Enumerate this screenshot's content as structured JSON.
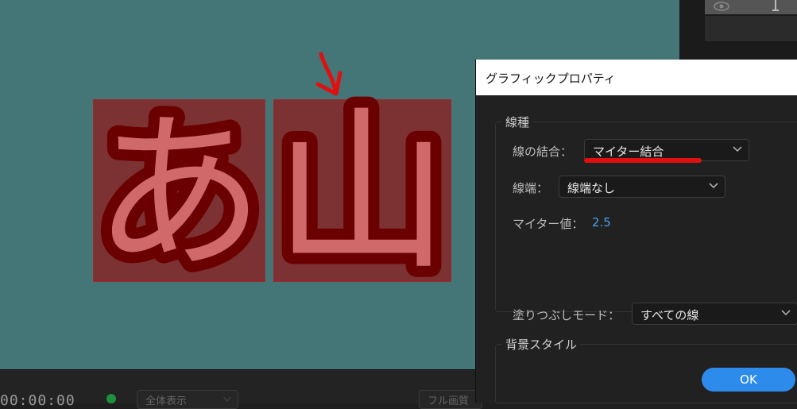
{
  "preview": {
    "glyph_left": "あ",
    "glyph_right": "山",
    "background_color": "#447577",
    "glyph_fill_color": "#d06a6a",
    "glyph_stroke_color": "#6b0000"
  },
  "layers_panel": {
    "visibility_icon": "eye-icon"
  },
  "timeline": {
    "timecode": "00:00:00",
    "view_mode": "全体表示",
    "fullscreen_label": "フル画質"
  },
  "dialog": {
    "title": "グラフィックプロパティ",
    "line_group": {
      "legend": "線種",
      "join_label": "線の結合：",
      "join_value": "マイター結合",
      "cap_label": "線端：",
      "cap_value": "線端なし",
      "miter_label": "マイター値：",
      "miter_value": "2.5"
    },
    "bg_group": {
      "legend": "背景スタイル",
      "fill_mode_label": "塗りつぶしモード：",
      "fill_mode_value": "すべての線"
    },
    "ok_label": "OK"
  },
  "annotations": {
    "underline_color": "#e01010",
    "arrow_color": "#e01010"
  }
}
